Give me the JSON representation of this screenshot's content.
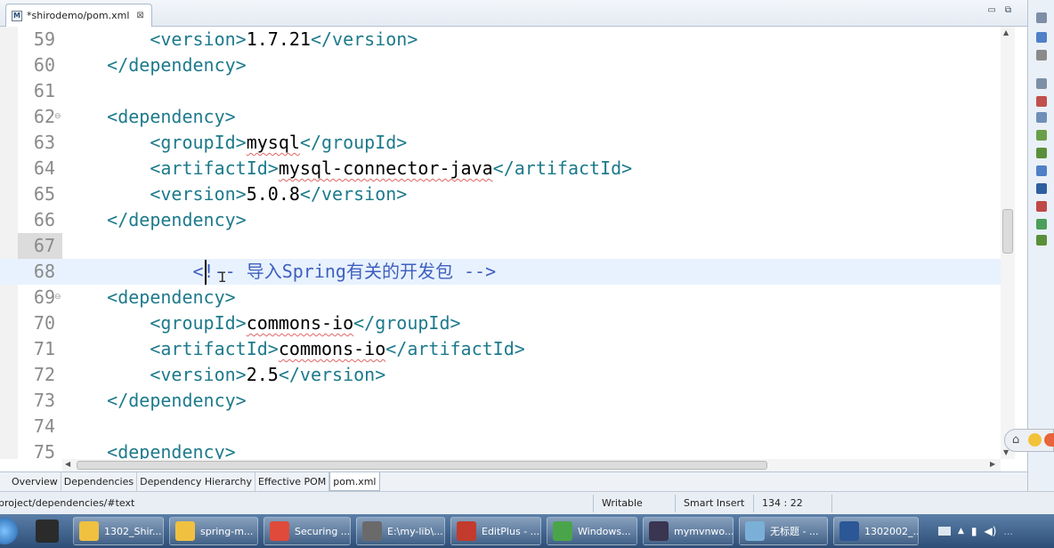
{
  "editor_tab": {
    "icon": "M",
    "title": "*shirodemo/pom.xml",
    "close": "⊠"
  },
  "window_controls": {
    "minimize": "▭",
    "restore": "⧉"
  },
  "lines": [
    {
      "n": "59",
      "indent": "        ",
      "parts": [
        [
          "t",
          "<version>"
        ],
        [
          "v",
          "1.7.21"
        ],
        [
          "t",
          "</version>"
        ]
      ]
    },
    {
      "n": "60",
      "indent": "    ",
      "parts": [
        [
          "t",
          "</dependency>"
        ]
      ]
    },
    {
      "n": "61",
      "indent": "",
      "parts": []
    },
    {
      "n": "62",
      "indent": "    ",
      "parts": [
        [
          "t",
          "<dependency>"
        ]
      ],
      "fold": true
    },
    {
      "n": "63",
      "indent": "        ",
      "parts": [
        [
          "t",
          "<groupId>"
        ],
        [
          "s",
          "mysql"
        ],
        [
          "t",
          "</groupId>"
        ]
      ]
    },
    {
      "n": "64",
      "indent": "        ",
      "parts": [
        [
          "t",
          "<artifactId>"
        ],
        [
          "s",
          "mysql-connector-java"
        ],
        [
          "t",
          "</artifactId>"
        ]
      ]
    },
    {
      "n": "65",
      "indent": "        ",
      "parts": [
        [
          "t",
          "<version>"
        ],
        [
          "v",
          "5.0.8"
        ],
        [
          "t",
          "</version>"
        ]
      ]
    },
    {
      "n": "66",
      "indent": "    ",
      "parts": [
        [
          "t",
          "</dependency>"
        ]
      ]
    },
    {
      "n": "67",
      "indent": "",
      "parts": [],
      "marked": true
    },
    {
      "n": "68",
      "indent": "            ",
      "parts": [
        [
          "c",
          "<!-- 导入Spring有关的开发包 -->"
        ]
      ],
      "current": true
    },
    {
      "n": "69",
      "indent": "    ",
      "parts": [
        [
          "t",
          "<dependency>"
        ]
      ],
      "fold": true
    },
    {
      "n": "70",
      "indent": "        ",
      "parts": [
        [
          "t",
          "<groupId>"
        ],
        [
          "s",
          "commons-io"
        ],
        [
          "t",
          "</groupId>"
        ]
      ]
    },
    {
      "n": "71",
      "indent": "        ",
      "parts": [
        [
          "t",
          "<artifactId>"
        ],
        [
          "s",
          "commons-io"
        ],
        [
          "t",
          "</artifactId>"
        ]
      ]
    },
    {
      "n": "72",
      "indent": "        ",
      "parts": [
        [
          "t",
          "<version>"
        ],
        [
          "v",
          "2.5"
        ],
        [
          "t",
          "</version>"
        ]
      ]
    },
    {
      "n": "73",
      "indent": "    ",
      "parts": [
        [
          "t",
          "</dependency>"
        ]
      ]
    },
    {
      "n": "74",
      "indent": "",
      "parts": []
    },
    {
      "n": "75",
      "indent": "    ",
      "parts": [
        [
          "t",
          "<dependency>"
        ]
      ]
    }
  ],
  "pom_tabs": [
    "Overview",
    "Dependencies",
    "Dependency Hierarchy",
    "Effective POM",
    "pom.xml"
  ],
  "pom_tabs_active": "pom.xml",
  "status": {
    "path": "project/dependencies/#text",
    "writable": "Writable",
    "insert_mode": "Smart Insert",
    "position": "134 : 22"
  },
  "taskbar": {
    "items": [
      {
        "label": "1302_Shir...",
        "icon": "folder-icon",
        "color": "#f0c040"
      },
      {
        "label": "spring-m...",
        "icon": "folder-icon",
        "color": "#f0c040"
      },
      {
        "label": "Securing ...",
        "icon": "chrome-icon",
        "color": "#e04a3a"
      },
      {
        "label": "E:\\my-lib\\...",
        "icon": "sublime-icon",
        "color": "#6a6a6a"
      },
      {
        "label": "EditPlus - ...",
        "icon": "editplus-icon",
        "color": "#c23b2c"
      },
      {
        "label": "Windows...",
        "icon": "windows-icon",
        "color": "#4aa54a"
      },
      {
        "label": "mymvnwo...",
        "icon": "eclipse-icon",
        "color": "#3a3550"
      },
      {
        "label": "无标题 - ...",
        "icon": "notepad-icon",
        "color": "#7ab0d8"
      },
      {
        "label": "1302002_...",
        "icon": "word-icon",
        "color": "#2b5797"
      }
    ],
    "tray_text": "..."
  },
  "colors": {
    "tag": "#1d7a8c",
    "comment": "#3f5fbf",
    "current_line": "#e8f2fe"
  }
}
